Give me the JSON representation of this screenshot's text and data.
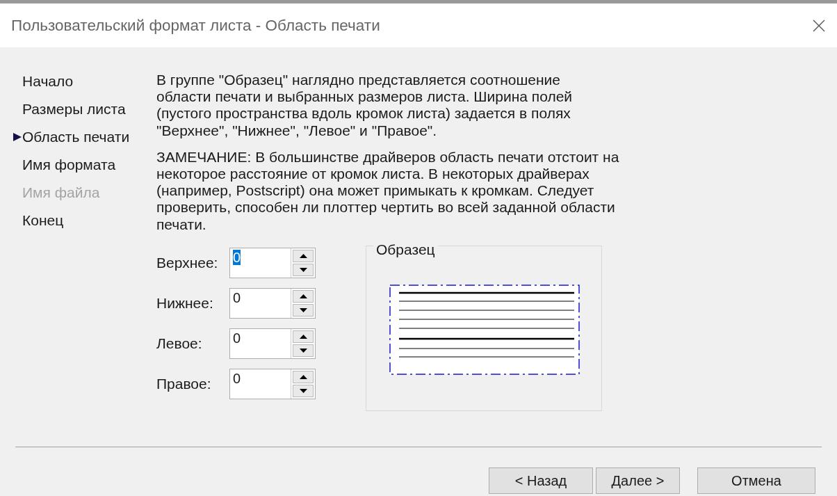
{
  "window": {
    "title": "Пользовательский формат листа - Область печати"
  },
  "steps": [
    {
      "label": "Начало",
      "selected": false,
      "disabled": false
    },
    {
      "label": "Размеры листа",
      "selected": false,
      "disabled": false
    },
    {
      "label": "Область печати",
      "selected": true,
      "disabled": false
    },
    {
      "label": "Имя формата",
      "selected": false,
      "disabled": false
    },
    {
      "label": "Имя файла",
      "selected": false,
      "disabled": true
    },
    {
      "label": "Конец",
      "selected": false,
      "disabled": false
    }
  ],
  "description": [
    [
      "В группе \"Образец\" наглядно представляется соотношение",
      "области печати и выбранных размеров листа. Ширина полей",
      "(пустого пространства вдоль кромок листа) задается в полях",
      "\"Верхнее\", \"Нижнее\", \"Левое\" и \"Правое\"."
    ],
    [
      "ЗАМЕЧАНИЕ: В большинстве драйверов область печати отстоит на",
      "некоторое расстояние от кромок листа. В некоторых драйверах",
      "(например, Postscript) она может примыкать к кромкам. Следует",
      "проверить, способен ли плоттер чертить во всей заданной области",
      "печати."
    ]
  ],
  "margins": [
    {
      "label": "Верхнее:",
      "value": "0",
      "focused": true
    },
    {
      "label": "Нижнее:",
      "value": "0",
      "focused": false
    },
    {
      "label": "Левое:",
      "value": "0",
      "focused": false
    },
    {
      "label": "Правое:",
      "value": "0",
      "focused": false
    }
  ],
  "sample": {
    "title": "Образец"
  },
  "buttons": [
    "< Назад",
    "Далее >",
    "Отмена"
  ]
}
